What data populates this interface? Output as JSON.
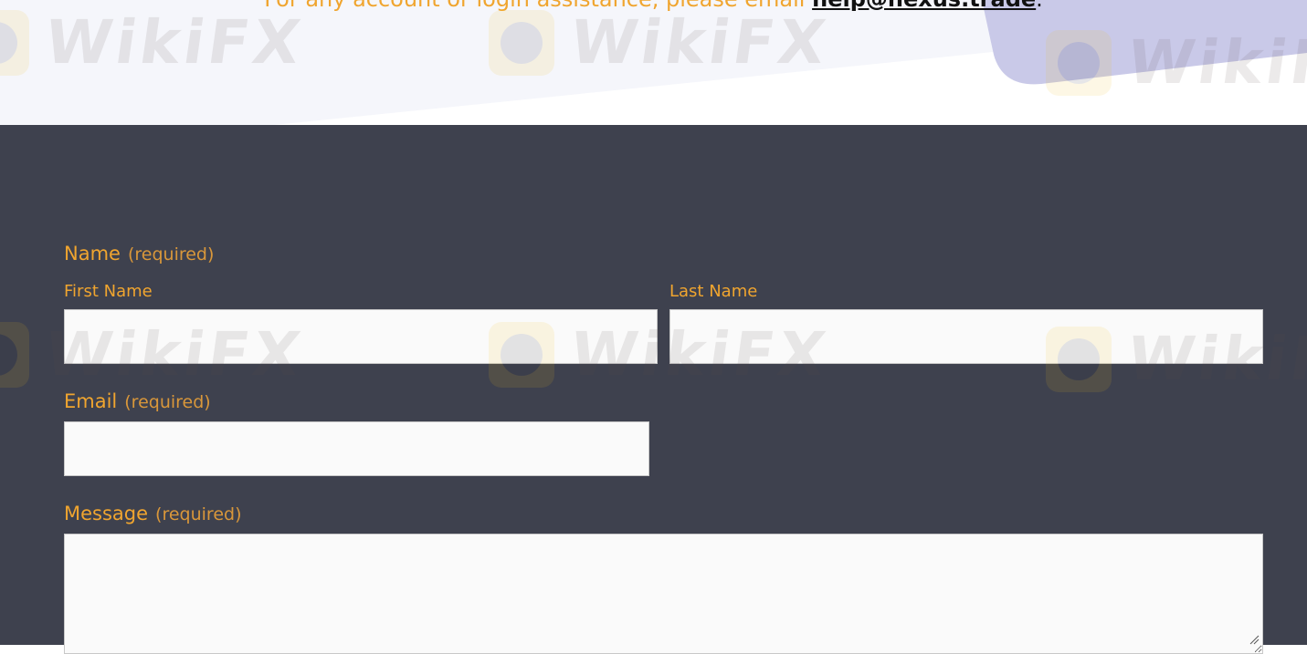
{
  "notice": {
    "prefix": "For any account or login assistance, please email ",
    "email": "help@nexus.trade",
    "suffix": "."
  },
  "form": {
    "name": {
      "label": "Name",
      "required": "(required)",
      "first_label": "First Name",
      "first_value": "",
      "last_label": "Last Name",
      "last_value": ""
    },
    "email": {
      "label": "Email",
      "required": "(required)",
      "value": ""
    },
    "message": {
      "label": "Message",
      "required": "(required)",
      "value": ""
    }
  },
  "watermark": {
    "text": "WikiFX",
    "icon": "eagle-logo-icon"
  },
  "colors": {
    "accent": "#f0a52f",
    "section_bg": "#3e414e",
    "field_bg": "#fafafa",
    "top_shape": "#c9c9e8"
  }
}
